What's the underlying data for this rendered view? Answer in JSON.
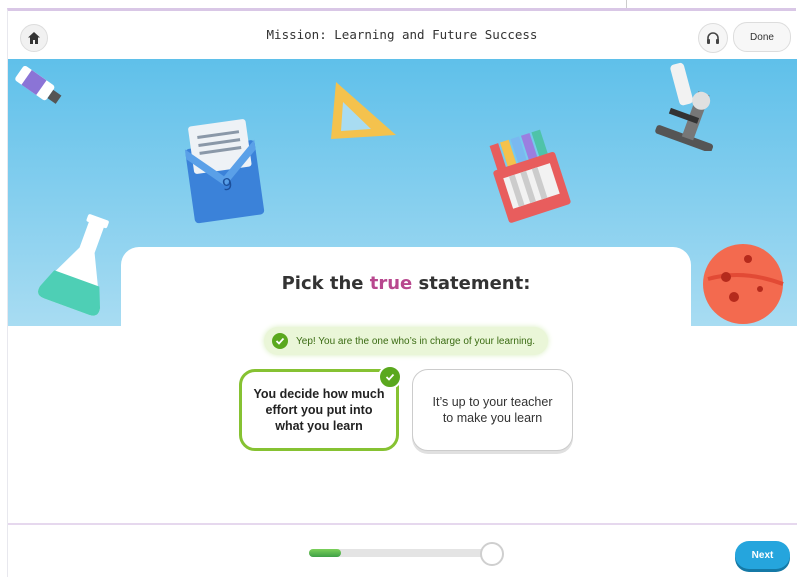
{
  "header": {
    "title": "Mission: Learning and Future Success",
    "done_label": "Done",
    "home_icon": "home-icon",
    "audio_icon": "headphones-icon"
  },
  "question": {
    "prefix": "Pick the ",
    "highlight": "true",
    "suffix": " statement:"
  },
  "feedback": {
    "text": "Yep! You are the one who’s in charge of your learning.",
    "icon": "check-icon"
  },
  "options": [
    {
      "text": "You decide how much effort you put into what you learn",
      "selected": true
    },
    {
      "text": "It’s up to your teacher to make you learn",
      "selected": false
    }
  ],
  "footer": {
    "next_label": "Next",
    "progress": 0.17
  },
  "colors": {
    "sky": "#5fc0ea",
    "correct_green": "#86c232",
    "highlight_purple": "#b8478e",
    "next_blue": "#25a5dd"
  }
}
